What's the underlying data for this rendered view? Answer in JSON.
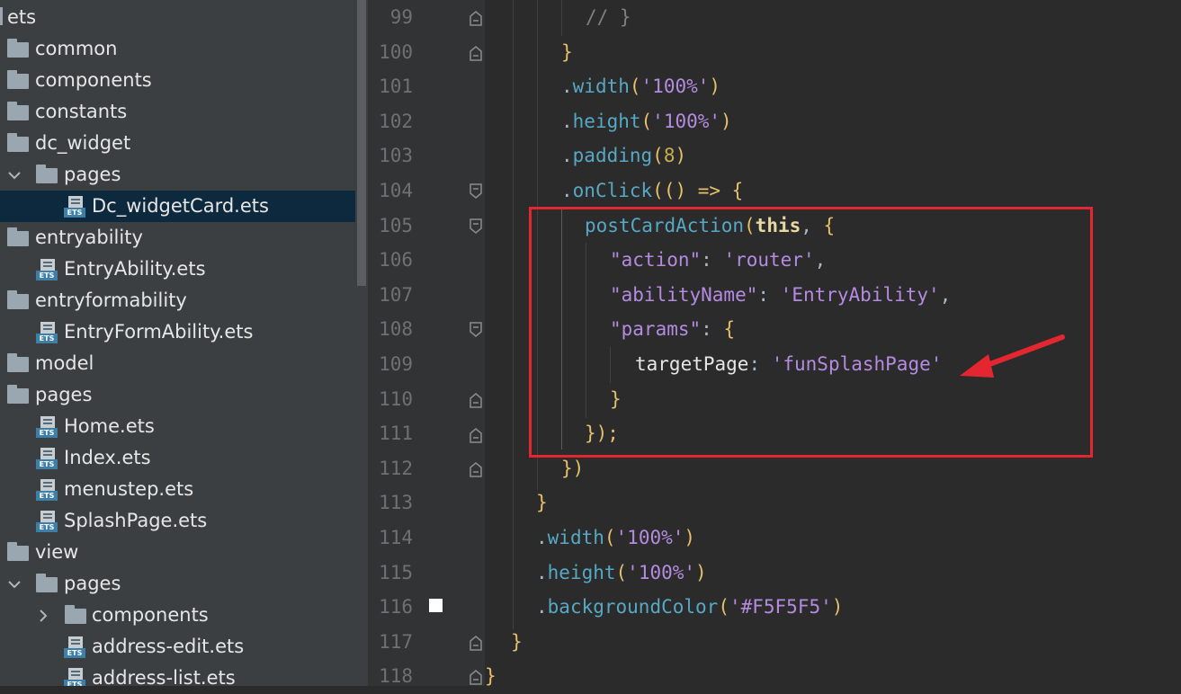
{
  "tree": {
    "root": "ets",
    "items": [
      {
        "label": "common",
        "type": "folder",
        "level": 0
      },
      {
        "label": "components",
        "type": "folder",
        "level": 0
      },
      {
        "label": "constants",
        "type": "folder",
        "level": 0
      },
      {
        "label": "dc_widget",
        "type": "folder",
        "level": 0
      },
      {
        "label": "pages",
        "type": "folder",
        "level": 1,
        "expanded": true
      },
      {
        "label": "Dc_widgetCard.ets",
        "type": "file",
        "level": 2,
        "selected": true
      },
      {
        "label": "entryability",
        "type": "folder",
        "level": 0
      },
      {
        "label": "EntryAbility.ets",
        "type": "file",
        "level": 1
      },
      {
        "label": "entryformability",
        "type": "folder",
        "level": 0
      },
      {
        "label": "EntryFormAbility.ets",
        "type": "file",
        "level": 1
      },
      {
        "label": "model",
        "type": "folder",
        "level": 0
      },
      {
        "label": "pages",
        "type": "folder",
        "level": 0
      },
      {
        "label": "Home.ets",
        "type": "file",
        "level": 1
      },
      {
        "label": "Index.ets",
        "type": "file",
        "level": 1
      },
      {
        "label": "menustep.ets",
        "type": "file",
        "level": 1
      },
      {
        "label": "SplashPage.ets",
        "type": "file",
        "level": 1
      },
      {
        "label": "view",
        "type": "folder",
        "level": 0
      },
      {
        "label": "pages",
        "type": "folder",
        "level": 1,
        "expanded": true
      },
      {
        "label": "components",
        "type": "folder",
        "level": 2,
        "collapsed": true
      },
      {
        "label": "address-edit.ets",
        "type": "file",
        "level": 2
      },
      {
        "label": "address-list.ets",
        "type": "file",
        "level": 2
      }
    ],
    "file_badge": "ETS"
  },
  "editor": {
    "line_numbers": [
      "99",
      "100",
      "101",
      "102",
      "103",
      "104",
      "105",
      "106",
      "107",
      "108",
      "109",
      "110",
      "111",
      "112",
      "113",
      "114",
      "115",
      "116",
      "117",
      "118"
    ],
    "code": {
      "l99": "// }",
      "l100": "}",
      "l101_fn": "width",
      "l101_arg": "'100%'",
      "l102_fn": "height",
      "l102_arg": "'100%'",
      "l103_fn": "padding",
      "l103_arg": "8",
      "l104_fn": "onClick",
      "l104_rest": "(() => {",
      "l105_fn": "postCardAction",
      "l105_kw": "this",
      "l106_key": "\"action\"",
      "l106_val": "'router'",
      "l107_key": "\"abilityName\"",
      "l107_val": "'EntryAbility'",
      "l108_key": "\"params\"",
      "l109_key": "targetPage",
      "l109_val": "'funSplashPage'",
      "l110": "}",
      "l111": "});",
      "l112": "})",
      "l113": "}",
      "l114_fn": "width",
      "l114_arg": "'100%'",
      "l115_fn": "height",
      "l115_arg": "'100%'",
      "l116_fn": "backgroundColor",
      "l116_arg": "'#F5F5F5'",
      "l117": "}",
      "l118": "}"
    },
    "highlight_color": "#e3262f"
  }
}
